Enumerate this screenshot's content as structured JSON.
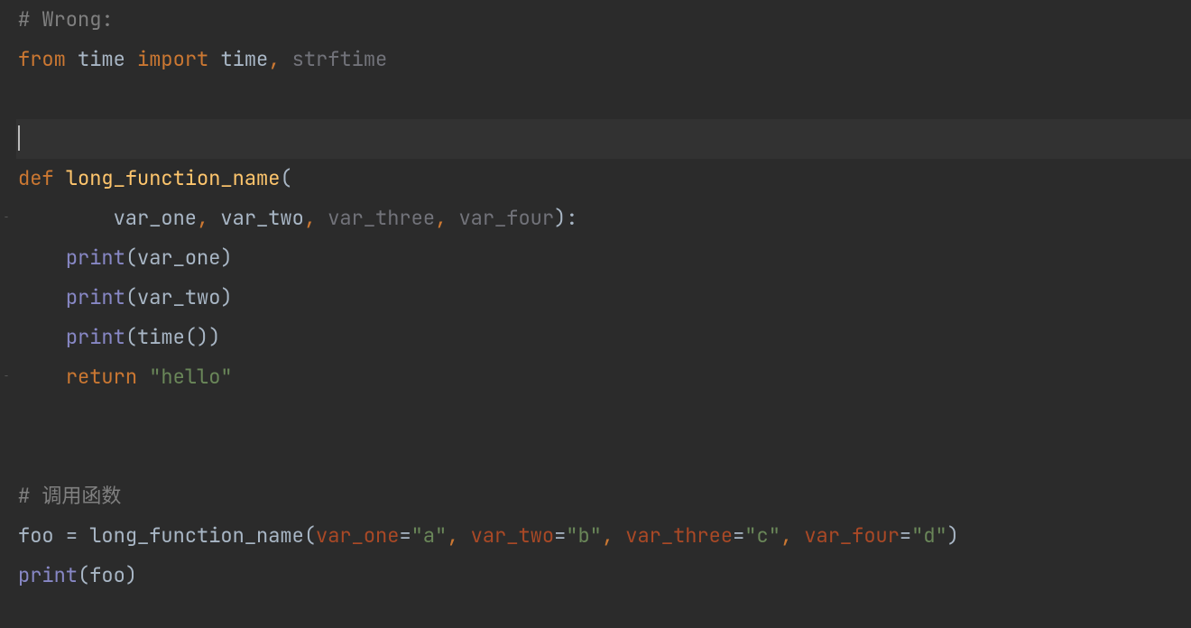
{
  "lines": {
    "l1": {
      "comment": "# Wrong:"
    },
    "l2": {
      "kw_from": "from",
      "mod": "time",
      "kw_import": "import",
      "name1": "time",
      "comma": ",",
      "name2": "strftime"
    },
    "l3": {},
    "l4": {},
    "l5": {
      "kw_def": "def",
      "func": "long_function_name",
      "lparen": "("
    },
    "l6": {
      "indent": "        ",
      "p1": "var_one",
      "c1": ",",
      "p2": "var_two",
      "c2": ",",
      "p3": "var_three",
      "c3": ",",
      "p4": "var_four",
      "rparen": ")",
      "colon": ":"
    },
    "l7": {
      "indent": "    ",
      "fn": "print",
      "lparen": "(",
      "arg": "var_one",
      "rparen": ")"
    },
    "l8": {
      "indent": "    ",
      "fn": "print",
      "lparen": "(",
      "arg": "var_two",
      "rparen": ")"
    },
    "l9": {
      "indent": "    ",
      "fn": "print",
      "lparen": "(",
      "call": "time",
      "ip": "(",
      "cp": ")",
      "rparen": ")"
    },
    "l10": {
      "indent": "    ",
      "kw_return": "return",
      "str": "\"hello\""
    },
    "l11": {},
    "l12": {},
    "l13": {
      "comment": "# 调用函数"
    },
    "l14": {
      "var": "foo",
      "eq": "=",
      "func": "long_function_name",
      "lparen": "(",
      "k1": "var_one",
      "e1": "=",
      "v1": "\"a\"",
      "c1": ",",
      "k2": "var_two",
      "e2": "=",
      "v2": "\"b\"",
      "c2": ",",
      "k3": "var_three",
      "e3": "=",
      "v3": "\"c\"",
      "c3": ",",
      "k4": "var_four",
      "e4": "=",
      "v4": "\"d\"",
      "rparen": ")"
    },
    "l15": {
      "fn": "print",
      "lparen": "(",
      "arg": "foo",
      "rparen": ")"
    }
  }
}
